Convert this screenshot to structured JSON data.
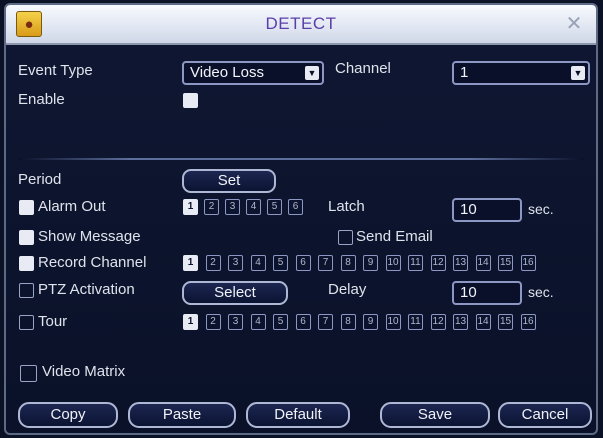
{
  "window": {
    "title": "DETECT",
    "title_icon": "app-logo-icon",
    "close_icon": "close-icon"
  },
  "event_type": {
    "label": "Event Type",
    "value": "Video Loss"
  },
  "channel": {
    "label": "Channel",
    "value": "1"
  },
  "enable": {
    "label": "Enable",
    "checked": true
  },
  "period": {
    "label": "Period",
    "button": "Set"
  },
  "alarm_out": {
    "label": "Alarm Out",
    "checked": true,
    "outputs": [
      {
        "n": "1",
        "on": true
      },
      {
        "n": "2",
        "on": false
      },
      {
        "n": "3",
        "on": false
      },
      {
        "n": "4",
        "on": false
      },
      {
        "n": "5",
        "on": false
      },
      {
        "n": "6",
        "on": false
      }
    ]
  },
  "latch": {
    "label": "Latch",
    "value": "10",
    "unit": "sec."
  },
  "show_message": {
    "label": "Show Message",
    "checked": true
  },
  "send_email": {
    "label": "Send Email",
    "checked": false
  },
  "record_channel": {
    "label": "Record Channel",
    "checked": true,
    "channels": [
      {
        "n": "1",
        "on": true
      },
      {
        "n": "2",
        "on": false
      },
      {
        "n": "3",
        "on": false
      },
      {
        "n": "4",
        "on": false
      },
      {
        "n": "5",
        "on": false
      },
      {
        "n": "6",
        "on": false
      },
      {
        "n": "7",
        "on": false
      },
      {
        "n": "8",
        "on": false
      },
      {
        "n": "9",
        "on": false
      },
      {
        "n": "10",
        "on": false
      },
      {
        "n": "11",
        "on": false
      },
      {
        "n": "12",
        "on": false
      },
      {
        "n": "13",
        "on": false
      },
      {
        "n": "14",
        "on": false
      },
      {
        "n": "15",
        "on": false
      },
      {
        "n": "16",
        "on": false
      }
    ]
  },
  "ptz_activation": {
    "label": "PTZ Activation",
    "checked": false,
    "button": "Select"
  },
  "delay": {
    "label": "Delay",
    "value": "10",
    "unit": "sec."
  },
  "tour": {
    "label": "Tour",
    "checked": false,
    "channels": [
      {
        "n": "1",
        "on": true
      },
      {
        "n": "2",
        "on": false
      },
      {
        "n": "3",
        "on": false
      },
      {
        "n": "4",
        "on": false
      },
      {
        "n": "5",
        "on": false
      },
      {
        "n": "6",
        "on": false
      },
      {
        "n": "7",
        "on": false
      },
      {
        "n": "8",
        "on": false
      },
      {
        "n": "9",
        "on": false
      },
      {
        "n": "10",
        "on": false
      },
      {
        "n": "11",
        "on": false
      },
      {
        "n": "12",
        "on": false
      },
      {
        "n": "13",
        "on": false
      },
      {
        "n": "14",
        "on": false
      },
      {
        "n": "15",
        "on": false
      },
      {
        "n": "16",
        "on": false
      }
    ]
  },
  "video_matrix": {
    "label": "Video Matrix",
    "checked": false
  },
  "buttons": {
    "copy": "Copy",
    "paste": "Paste",
    "default": "Default",
    "save": "Save",
    "cancel": "Cancel"
  },
  "colors": {
    "background": "#0a1029",
    "title_text": "#5a3fa8",
    "checked": "#e8ebf3"
  }
}
